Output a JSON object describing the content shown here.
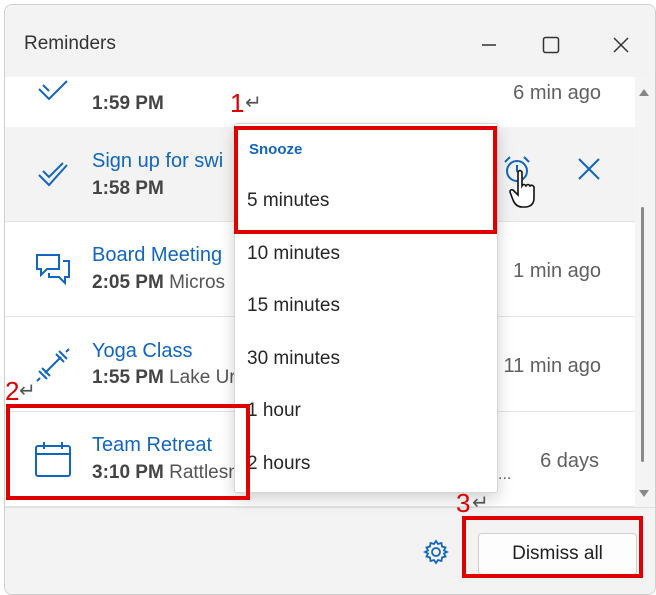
{
  "window": {
    "title": "Reminders",
    "controls": [
      "minimize-icon",
      "maximize-icon",
      "close-icon"
    ]
  },
  "reminders": [
    {
      "subject": "",
      "time": "1:59 PM",
      "location": "",
      "ago": "6 min ago",
      "icon": "checkmark-icon"
    },
    {
      "subject": "Sign up for swi",
      "time": "1:58 PM",
      "location": "",
      "ago": "",
      "icon": "checkmark-icon",
      "selected": true
    },
    {
      "subject": "Board Meeting",
      "time": "2:05 PM",
      "location": "Micros",
      "ago": "1 min ago",
      "icon": "chat-bubbles-icon"
    },
    {
      "subject": "Yoga Class",
      "time": "1:55 PM",
      "location": "Lake Ur",
      "ago": "11 min ago",
      "icon": "dumbbell-icon"
    },
    {
      "subject": "Team Retreat",
      "time": "3:10 PM",
      "location": "Rattlesn",
      "ago": "6 days",
      "extra": "...",
      "icon": "calendar-icon"
    }
  ],
  "snooze_menu": {
    "header": "Snooze",
    "options": [
      "5 minutes",
      "10 minutes",
      "15 minutes",
      "30 minutes",
      "1 hour",
      "2 hours"
    ]
  },
  "footer": {
    "dismiss_all": "Dismiss all",
    "settings_icon": "gear-icon"
  },
  "annotations": {
    "marks": [
      "1",
      "2",
      "3"
    ],
    "return_glyph": "↵",
    "color": "#e00000"
  },
  "colors": {
    "accent": "#1166c0",
    "annotation": "#e00000"
  }
}
